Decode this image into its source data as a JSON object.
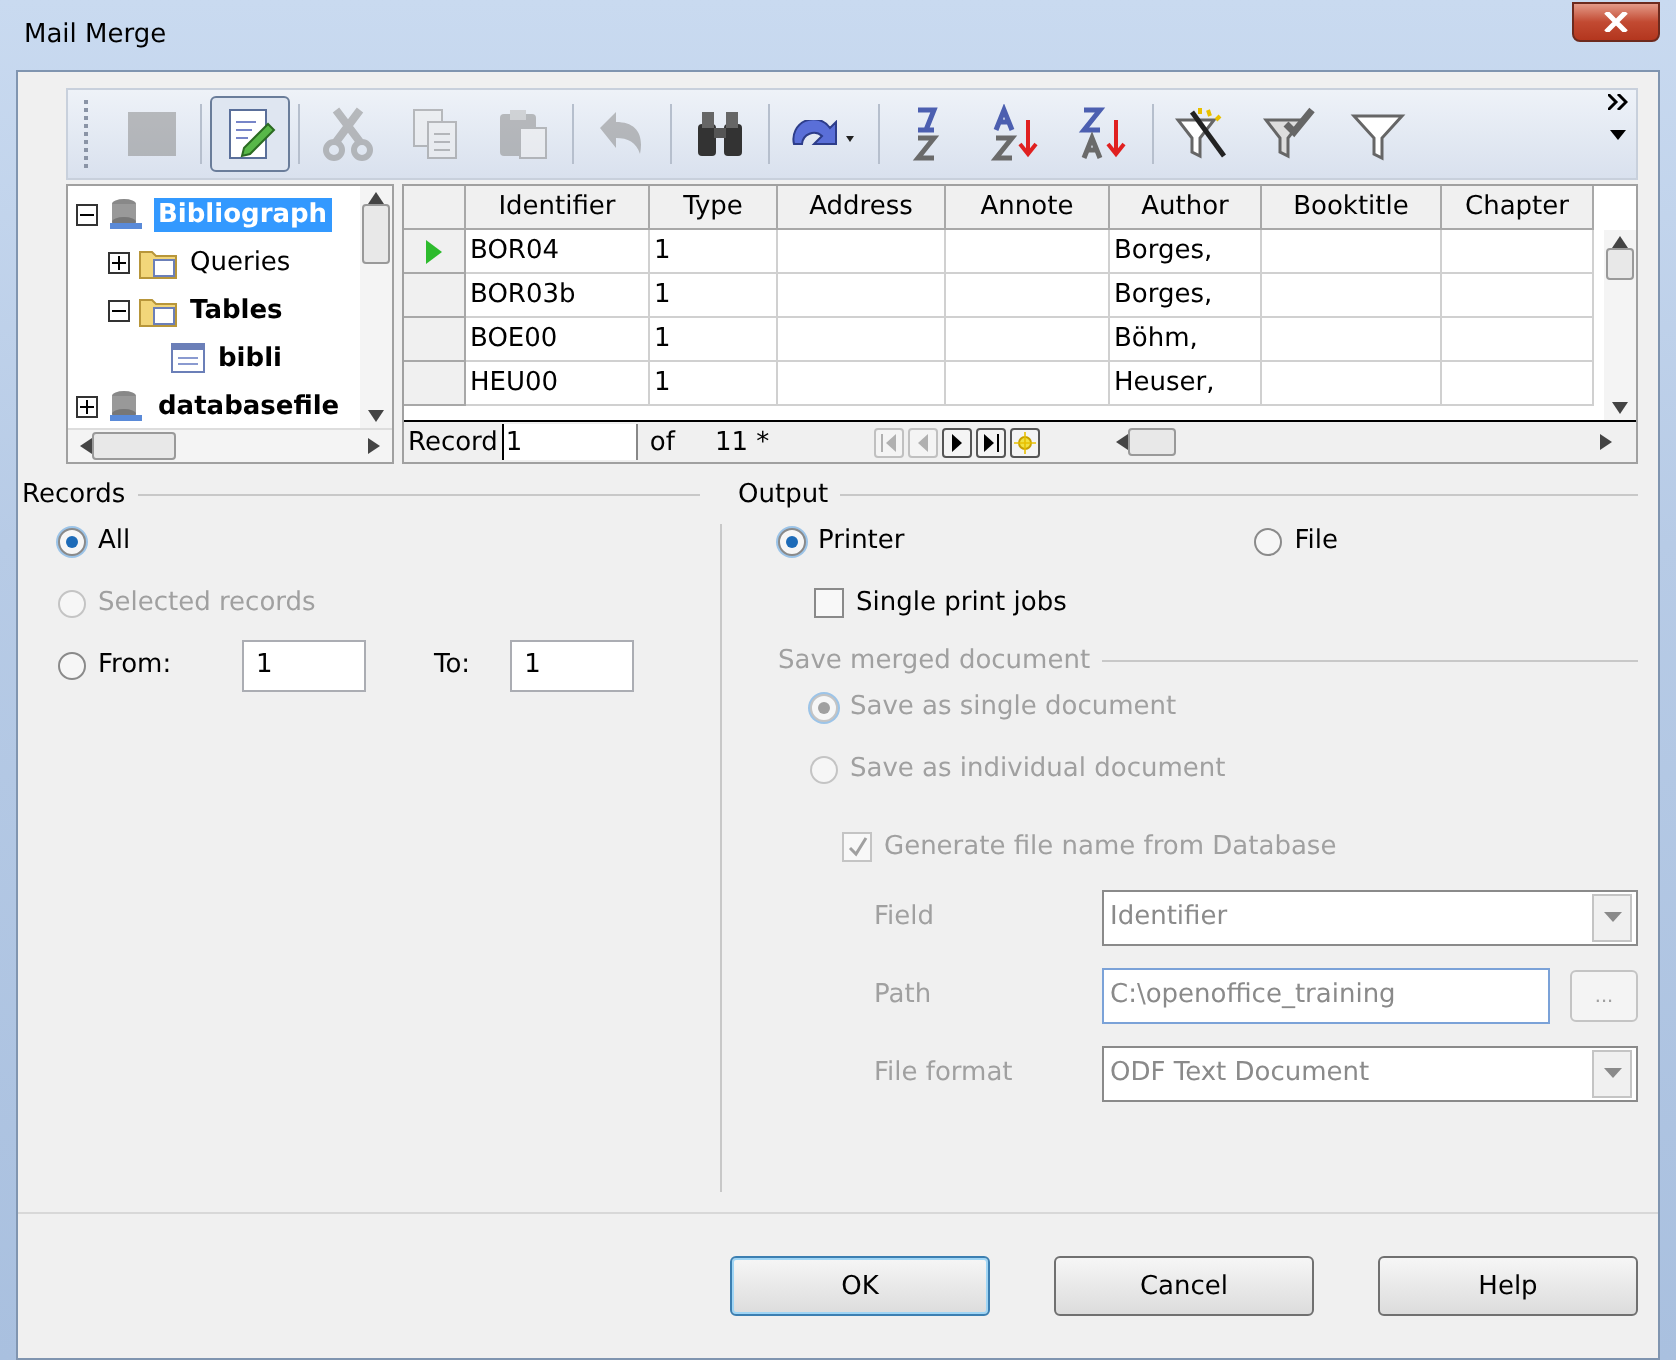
{
  "window": {
    "title": "Mail Merge"
  },
  "toolbar": [
    {
      "kind": "explorer",
      "disabled": true,
      "selected": false
    },
    {
      "kind": "edit",
      "disabled": false,
      "selected": true
    },
    {
      "kind": "cut",
      "disabled": true,
      "selected": false
    },
    {
      "kind": "copy",
      "disabled": true,
      "selected": false
    },
    {
      "kind": "paste",
      "disabled": true,
      "selected": false
    },
    {
      "kind": "undo",
      "disabled": true,
      "selected": false
    },
    {
      "kind": "find",
      "disabled": false,
      "selected": false
    },
    {
      "kind": "redo",
      "disabled": false,
      "selected": false
    },
    {
      "kind": "sort",
      "disabled": false,
      "selected": false
    },
    {
      "kind": "sort-asc",
      "disabled": false,
      "selected": false
    },
    {
      "kind": "sort-desc",
      "disabled": false,
      "selected": false
    },
    {
      "kind": "autofilter",
      "disabled": false,
      "selected": false
    },
    {
      "kind": "standard-filter",
      "disabled": false,
      "selected": false
    },
    {
      "kind": "remove-filter",
      "disabled": false,
      "selected": false
    }
  ],
  "tree": [
    {
      "label": "Bibliograph",
      "kind": "database",
      "selected": true,
      "expanded": true,
      "children": [
        {
          "label": "Queries",
          "kind": "folder",
          "selected": false,
          "expanded": false
        },
        {
          "label": "Tables",
          "kind": "folder",
          "selected": false,
          "expanded": true,
          "children": [
            {
              "label": "bibli",
              "kind": "table",
              "selected": false
            }
          ]
        }
      ]
    },
    {
      "label": "databasefile",
      "kind": "database",
      "selected": false,
      "expanded": false
    }
  ],
  "table": {
    "columns": [
      "Identifier",
      "Type",
      "Address",
      "Annote",
      "Author",
      "Booktitle",
      "Chapter"
    ],
    "rows": [
      {
        "selected": true,
        "cells": [
          "BOR04",
          "1",
          "",
          "",
          "Borges,",
          "",
          ""
        ]
      },
      {
        "selected": false,
        "cells": [
          "BOR03b",
          "1",
          "",
          "",
          "Borges,",
          "",
          ""
        ]
      },
      {
        "selected": false,
        "cells": [
          "BOE00",
          "1",
          "",
          "",
          "Böhm,",
          "",
          ""
        ]
      },
      {
        "selected": false,
        "cells": [
          "HEU00",
          "1",
          "",
          "",
          "Heuser,",
          "",
          ""
        ]
      }
    ],
    "navigator": {
      "label": "Record",
      "value": "1",
      "of": "of",
      "count": "11 *",
      "buttons": [
        {
          "kind": "first",
          "disabled": true
        },
        {
          "kind": "prev",
          "disabled": true
        },
        {
          "kind": "next",
          "disabled": false
        },
        {
          "kind": "last",
          "disabled": false
        },
        {
          "kind": "new",
          "disabled": false
        }
      ]
    }
  },
  "records": {
    "title": "Records",
    "options": [
      {
        "label": "All",
        "selected": true,
        "disabled": false
      },
      {
        "label": "Selected records",
        "selected": false,
        "disabled": true
      },
      {
        "label": "From:",
        "selected": false,
        "disabled": false
      }
    ],
    "to_label": "To:",
    "from_value": "1",
    "to_value": "1"
  },
  "output": {
    "title": "Output",
    "options": [
      {
        "label": "Printer",
        "selected": true
      },
      {
        "label": "File",
        "selected": false
      }
    ],
    "single_print_jobs": {
      "label": "Single print jobs",
      "checked": false
    },
    "save": {
      "title": "Save merged document",
      "disabled": true,
      "options": [
        {
          "label": "Save as single document",
          "selected": true
        },
        {
          "label": "Save as individual document",
          "selected": false
        }
      ],
      "generate": {
        "label": "Generate file name from Database",
        "checked": true
      },
      "field": {
        "label": "Field",
        "value": "Identifier"
      },
      "path": {
        "label": "Path",
        "value": "C:\\openoffice_training",
        "browse": "..."
      },
      "file_format": {
        "label": "File format",
        "value": "ODF Text Document"
      }
    }
  },
  "buttons": [
    {
      "label": "OK",
      "default": true
    },
    {
      "label": "Cancel",
      "default": false
    },
    {
      "label": "Help",
      "default": false
    }
  ]
}
